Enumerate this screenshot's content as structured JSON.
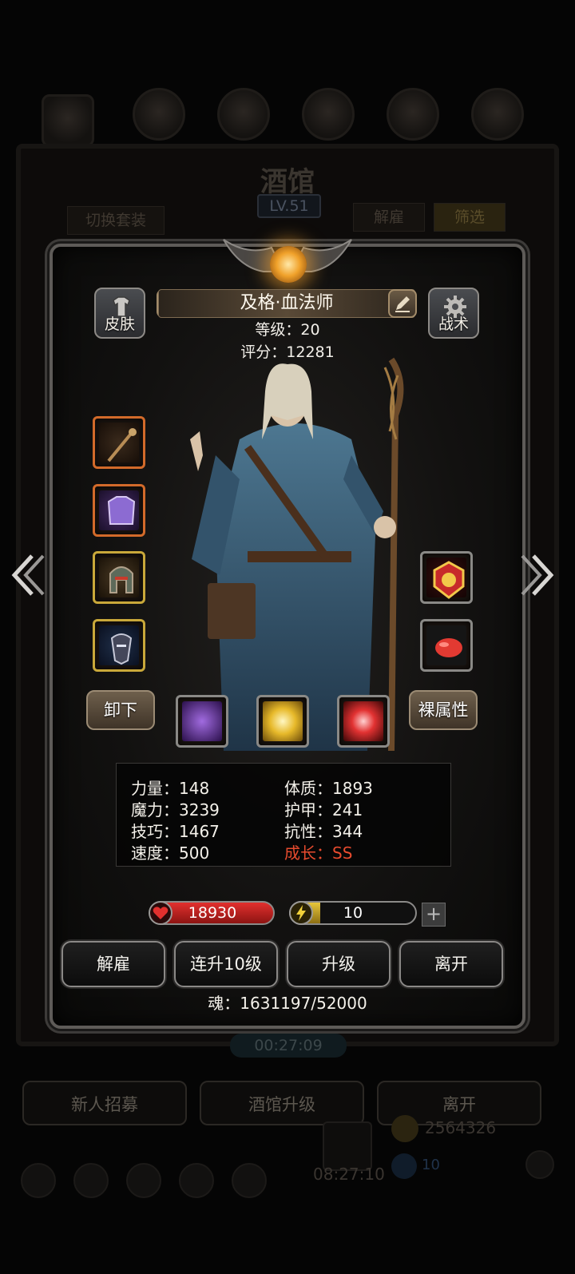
{
  "background": {
    "title": "酒馆",
    "level": "LV.51",
    "switch_outfit": "切换套装",
    "dismiss": "解雇",
    "filter": "筛选",
    "timer": "00:27:09",
    "bottom_buttons": [
      "新人招募",
      "酒馆升级",
      "离开"
    ],
    "gold": "2564326",
    "clock": "08:27:10",
    "gem_count": "10"
  },
  "hero": {
    "name": "及格·血法师",
    "level_line": "等级：20",
    "score_line": "评分：12281",
    "skin_label": "皮肤",
    "tactics_label": "战术"
  },
  "buttons": {
    "unequip": "卸下",
    "base_attr": "裸属性"
  },
  "stats": {
    "strength": "力量：148",
    "magic": "魔力：3239",
    "skill": "技巧：1467",
    "speed": "速度：500",
    "constitution": "体质：1893",
    "armor": "护甲：241",
    "resistance": "抗性：344",
    "growth": "成长：SS"
  },
  "bars": {
    "hp": "18930",
    "energy": "10",
    "plus": "+"
  },
  "actions": {
    "dismiss": "解雇",
    "level_up_10": "连升10级",
    "level_up": "升级",
    "leave": "离开"
  },
  "soul_line": "魂：1631197/52000",
  "colors": {
    "growth_red": "#e74b2e",
    "hp_red": "#e2302e",
    "energy_yellow": "#e7c63b"
  }
}
